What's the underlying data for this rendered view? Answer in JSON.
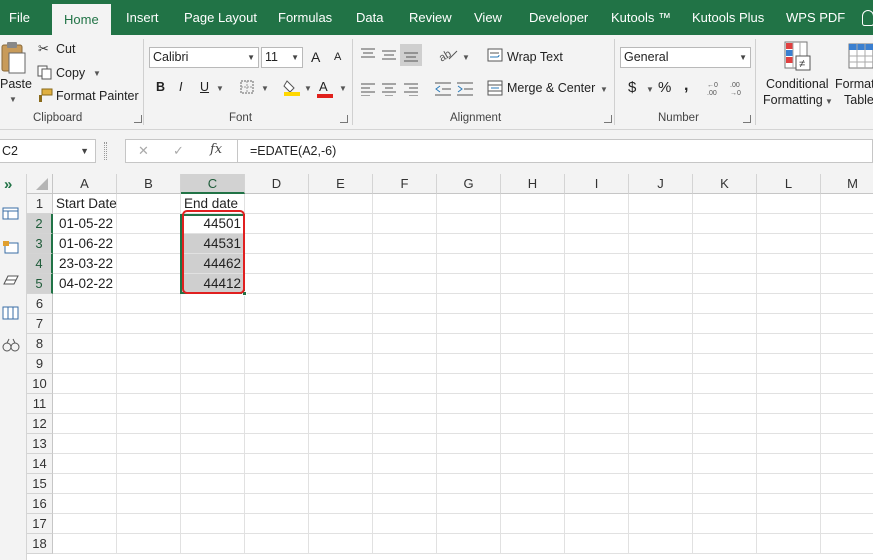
{
  "ribbon_tabs": [
    "File",
    "Home",
    "Insert",
    "Page Layout",
    "Formulas",
    "Data",
    "Review",
    "View",
    "Developer",
    "Kutools ™",
    "Kutools Plus",
    "WPS PDF"
  ],
  "clipboard": {
    "paste": "Paste",
    "cut": "Cut",
    "copy": "Copy",
    "format_painter": "Format Painter",
    "label": "Clipboard"
  },
  "font": {
    "name": "Calibri",
    "size": "11",
    "bold": "B",
    "italic": "I",
    "underline": "U",
    "grow": "A",
    "shrink": "A",
    "font_color": "A",
    "label": "Font"
  },
  "alignment": {
    "wrap_text": "Wrap Text",
    "merge_center": "Merge & Center",
    "label": "Alignment"
  },
  "number": {
    "format": "General",
    "currency": "$",
    "percent": "%",
    "comma": ",",
    "label": "Number"
  },
  "styles": {
    "conditional_line1": "Conditional",
    "conditional_line2": "Formatting",
    "format_line1": "Format",
    "format_line2": "Table"
  },
  "formula_bar": {
    "name_box": "C2",
    "formula": "=EDATE(A2,-6)",
    "cancel": "✕",
    "enter": "✓",
    "fx": "fx"
  },
  "columns": [
    "A",
    "B",
    "C",
    "D",
    "E",
    "F",
    "G",
    "H",
    "I",
    "J",
    "K",
    "L",
    "M"
  ],
  "rows": [
    "1",
    "2",
    "3",
    "4",
    "5",
    "6",
    "7",
    "8",
    "9",
    "10",
    "11",
    "12",
    "13",
    "14",
    "15",
    "16",
    "17",
    "18"
  ],
  "cells": {
    "A1": "Start Date",
    "C1": "End date",
    "A2": "01-05-22",
    "C2": "44501",
    "A3": "01-06-22",
    "C3": "44531",
    "A4": "23-03-22",
    "C4": "44462",
    "A5": "04-02-22",
    "C5": "44412"
  },
  "colors": {
    "excel_green": "#217346",
    "highlight_red": "#e02020",
    "selection_gray": "#cfcfcf"
  }
}
